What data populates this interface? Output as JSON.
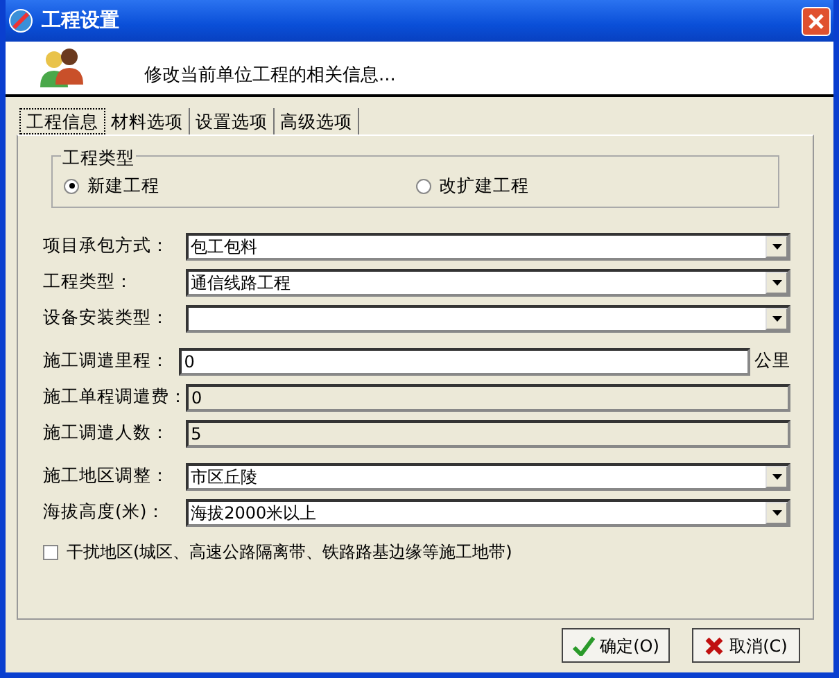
{
  "window": {
    "title": "工程设置"
  },
  "header": {
    "text": "修改当前单位工程的相关信息..."
  },
  "tabs": [
    {
      "label": "工程信息",
      "selected": true
    },
    {
      "label": "材料选项",
      "selected": false
    },
    {
      "label": "设置选项",
      "selected": false
    },
    {
      "label": "高级选项",
      "selected": false
    }
  ],
  "project_type": {
    "legend": "工程类型",
    "options": [
      {
        "label": "新建工程",
        "selected": true
      },
      {
        "label": "改扩建工程",
        "selected": false
      }
    ]
  },
  "field_groups": [
    [
      {
        "label": "项目承包方式：",
        "kind": "combo",
        "value": "包工包料"
      },
      {
        "label": "工程类型：",
        "kind": "combo",
        "value": "通信线路工程"
      },
      {
        "label": "设备安装类型：",
        "kind": "combo"
      }
    ],
    [
      {
        "label": "施工调遣里程：",
        "kind": "text",
        "value": "0",
        "unit": "公里",
        "disabled": false
      },
      {
        "label": "施工单程调遣费：",
        "kind": "text",
        "value": "0",
        "disabled": true
      },
      {
        "label": "施工调遣人数：",
        "kind": "text",
        "value": "5",
        "disabled": true
      }
    ],
    [
      {
        "label": "施工地区调整：",
        "kind": "combo",
        "value": "市区丘陵"
      },
      {
        "label": "海拔高度(米)：",
        "kind": "combo",
        "value": "海拔2000米以上"
      }
    ]
  ],
  "interference": {
    "label": "干扰地区(城区、高速公路隔离带、铁路路基边缘等施工地带)",
    "checked": false
  },
  "buttons": [
    {
      "label": "确定(O)",
      "kind": "ok"
    },
    {
      "label": "取消(C)",
      "kind": "cancel"
    }
  ]
}
